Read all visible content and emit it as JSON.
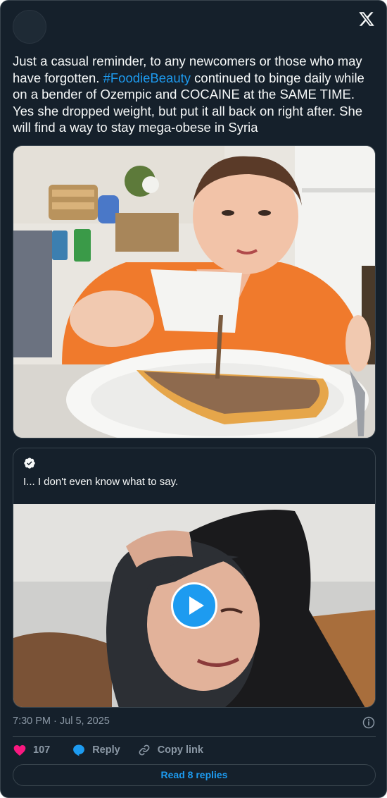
{
  "tweet": {
    "text_before": "Just a casual reminder, to any newcomers or those who may have forgotten. ",
    "hashtag": "#FoodieBeauty",
    "text_after": " continued to binge daily while on a bender of Ozempic and COCAINE at the SAME TIME. Yes she dropped weight, but put it all back on right after. She will find a way to stay mega-obese in Syria",
    "timestamp": "7:30 PM · Jul 5, 2025"
  },
  "quote": {
    "text": "I... I don't even know what to say."
  },
  "actions": {
    "like_count": "107",
    "reply_label": "Reply",
    "copy_label": "Copy link"
  },
  "read_replies": "Read 8 replies",
  "icons": {
    "brand": "x-logo-icon",
    "verified": "verified-badge-icon",
    "play": "play-icon",
    "info": "info-icon",
    "like": "heart-icon",
    "reply": "reply-bubble-icon",
    "copy": "link-icon"
  },
  "colors": {
    "background": "#15202b",
    "border": "#38444d",
    "accent": "#1d9bf0",
    "like": "#f91880",
    "text": "#f7f9f9",
    "muted": "#8b98a5"
  }
}
